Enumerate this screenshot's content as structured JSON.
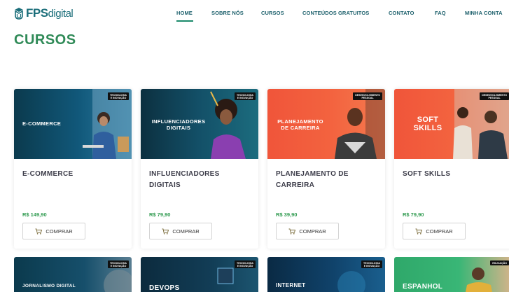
{
  "brand": {
    "logo_bold": "FPS",
    "logo_light": "digital"
  },
  "nav": {
    "items": [
      "HOME",
      "SOBRE NÓS",
      "CURSOS",
      "CONTEÚDOS GRATUITOS",
      "CONTATO",
      "FAQ",
      "MINHA CONTA"
    ],
    "active": "HOME"
  },
  "page": {
    "title": "CURSOS"
  },
  "colors": {
    "brand": "#1b6e7a",
    "heading": "#2f8a57",
    "price": "#2f9a4f"
  },
  "courses": [
    {
      "img_title": "E-COMMERCE",
      "badge": "TECNOLOGIA\nE INOVAÇÃO",
      "title": "E-COMMERCE",
      "price": "R$ 149,90",
      "buy": "COMPRAR"
    },
    {
      "img_title": "INFLUENCIADORES\nDIGITAIS",
      "badge": "TECNOLOGIA\nE INOVAÇÃO",
      "title": "INFLUENCIADORES\nDIGITAIS",
      "price": "R$ 79,90",
      "buy": "COMPRAR"
    },
    {
      "img_title": "PLANEJAMENTO\nDE CARREIRA",
      "badge": "DESENVOLVIMENTO\nPESSOAL",
      "title": "PLANEJAMENTO DE\nCARREIRA",
      "price": "R$ 39,90",
      "buy": "COMPRAR"
    },
    {
      "img_title": "SOFT\nSKILLS",
      "badge": "DESENVOLVIMENTO\nPESSOAL",
      "title": "SOFT SKILLS",
      "price": "R$ 79,90",
      "buy": "COMPRAR"
    }
  ],
  "courses_row2": [
    {
      "img_title": "JORNALISMO DIGITAL",
      "badge": "TECNOLOGIA\nE INOVAÇÃO"
    },
    {
      "img_title": "DEVOPS",
      "badge": "TECNOLOGIA\nE INOVAÇÃO"
    },
    {
      "img_title": "INTERNET",
      "badge": "TECNOLOGIA\nE INOVAÇÃO"
    },
    {
      "img_title": "ESPANHOL",
      "badge": "EDUCAÇÃO"
    }
  ]
}
